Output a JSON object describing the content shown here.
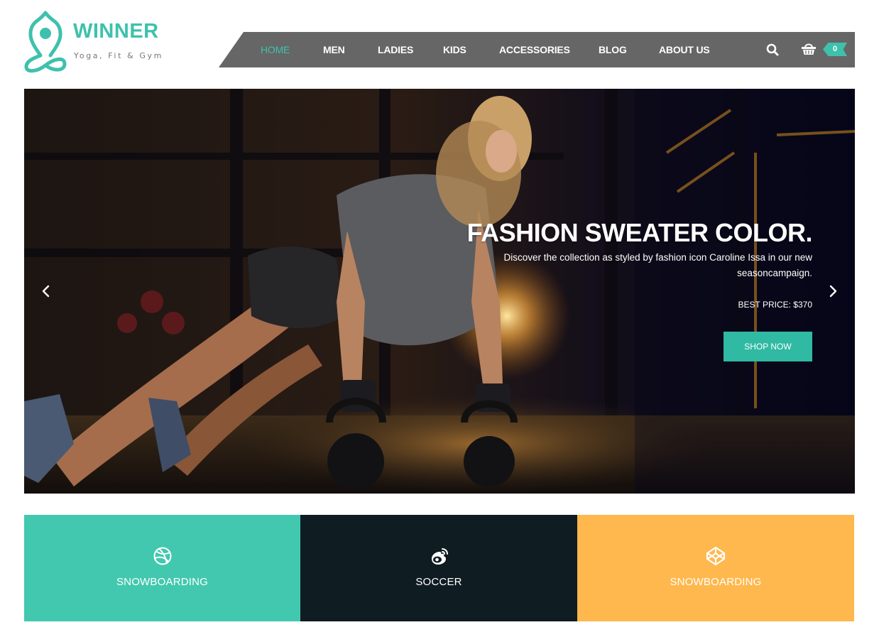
{
  "brand": {
    "name": "WINNER",
    "tagline": "Yoga, Fit & Gym",
    "accent_color": "#3ec1ac",
    "logo_icon": "yoga-lotus-icon"
  },
  "nav": {
    "items": [
      {
        "label": "HOME",
        "active": true
      },
      {
        "label": "MEN",
        "active": false
      },
      {
        "label": "LADIES",
        "active": false
      },
      {
        "label": "KIDS",
        "active": false
      },
      {
        "label": "ACCESSORIES",
        "active": false
      },
      {
        "label": "BLOG",
        "active": false
      },
      {
        "label": "ABOUT US",
        "active": false
      }
    ],
    "search_icon": "search-icon",
    "cart_icon": "basket-icon",
    "cart_count": "0",
    "background_color": "#666666"
  },
  "hero": {
    "title": "FASHION SWEATER COLOR.",
    "description": "Discover the collection as styled by fashion icon Caroline Issa in our new seasoncampaign.",
    "price": "BEST PRICE: $370",
    "cta_label": "SHOP NOW",
    "cta_color": "#30b9a3",
    "prev_icon": "chevron-left-icon",
    "next_icon": "chevron-right-icon"
  },
  "categories": [
    {
      "label": "SNOWBOARDING",
      "icon": "dribbble-icon",
      "color": "#42c8ae"
    },
    {
      "label": "SOCCER",
      "icon": "weibo-icon",
      "color": "#0f1c21"
    },
    {
      "label": "SNOWBOARDING",
      "icon": "codepen-icon",
      "color": "#ffb84d"
    }
  ]
}
